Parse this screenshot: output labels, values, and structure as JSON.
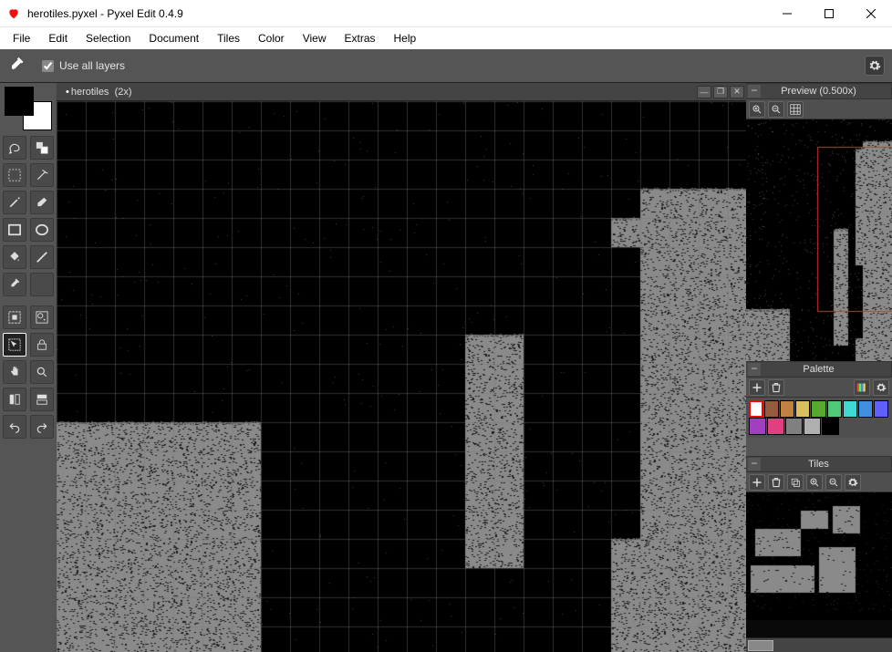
{
  "window": {
    "title": "herotiles.pyxel - Pyxel Edit 0.4.9"
  },
  "menus": [
    "File",
    "Edit",
    "Selection",
    "Document",
    "Tiles",
    "Color",
    "View",
    "Extras",
    "Help"
  ],
  "toolstrip": {
    "checkbox_label": "Use all layers",
    "checkbox_checked": true
  },
  "document_tab": {
    "modified": true,
    "name": "herotiles",
    "zoom": "(2x)"
  },
  "toolbox": {
    "foreground_color": "#000000",
    "background_color": "#ffffff",
    "tools": [
      [
        "lasso-icon",
        "fill-swap-icon"
      ],
      [
        "marquee-icon",
        "wand-icon"
      ],
      [
        "pencil-icon",
        "eraser-icon"
      ],
      [
        "rect-icon",
        "ellipse-icon"
      ],
      [
        "bucket-icon",
        "line-icon"
      ],
      [
        "eyedropper-icon",
        ""
      ]
    ],
    "tile_tools": [
      [
        "tile-region-icon",
        "tile-select-icon"
      ],
      [
        "tile-place-icon",
        "tile-lock-icon"
      ],
      [
        "hand-icon",
        "zoom-icon"
      ],
      [
        "flip-h-icon",
        "flip-v-icon"
      ],
      [
        "undo-icon",
        "redo-icon"
      ]
    ]
  },
  "panels": {
    "preview": {
      "title": "Preview (0.500x)",
      "buttons": [
        "zoom-in-icon",
        "zoom-out-icon",
        "grid-icon"
      ]
    },
    "palette": {
      "title": "Palette",
      "buttons_left": [
        "add-icon",
        "delete-icon"
      ],
      "buttons_right": [
        "rainbow-icon",
        "gear-icon"
      ],
      "rows": [
        [
          "#ffffff",
          "#965a3e",
          "#c08040",
          "#d8c060",
          "#58a830",
          "#50c878",
          "#40d8d0",
          "#4090e0",
          "#6060ff"
        ],
        [
          "#a040c0",
          "#e04080",
          "#808080",
          "#b0b0b0",
          "#000000"
        ]
      ],
      "selected": [
        0,
        0
      ]
    },
    "tiles": {
      "title": "Tiles",
      "buttons": [
        "add-icon",
        "delete-icon",
        "copy-icon",
        "zoom-in-icon",
        "zoom-out-icon",
        "gear-icon"
      ]
    }
  }
}
